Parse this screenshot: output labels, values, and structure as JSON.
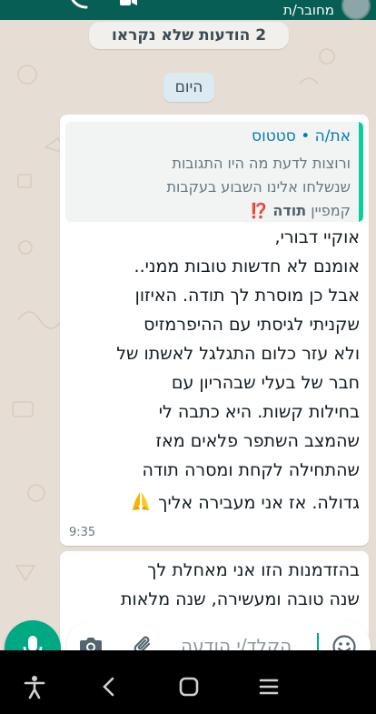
{
  "header": {
    "status": "מחובר/ת"
  },
  "chat": {
    "unread_banner": "2 הודעות שלא נקראו",
    "date_divider": "היום",
    "message1": {
      "quote": {
        "title": "את/ה • סטטוס",
        "line1": "ורוצות לדעת מה היו התגובות",
        "line2": "שנשלחו אלינו השבוע בעקבות",
        "line3_prefix": "קמפיין",
        "line3_bold": "תודה",
        "line3_emoji": "⁉️"
      },
      "lines": [
        "אוקיי דבורי,",
        "אומנם לא חדשות טובות ממני..",
        "אבל כן מוסרת לך תודה. האיזון",
        "שקניתי לגיסתי עם ההיפרמזיס",
        "ולא עזר כלום התגלגל לאשתו של",
        "חבר של בעלי שבהריון עם",
        "בחילות קשות. היא כתבה לי",
        "שהמצב השתפר פלאים מאז",
        "שהתחילה לקחת ומסרה תודה",
        "גדולה. אז אני מעבירה אליך"
      ],
      "time": "9:35"
    },
    "message2": {
      "lines": [
        "בהזדמנות הזו אני מאחלת לך",
        "שנה טובה ומעשירה, שנה מלאות"
      ]
    }
  },
  "composer": {
    "placeholder": "הקלד/י הודעה"
  },
  "icons": {
    "mic": "microphone-icon",
    "camera": "camera-icon",
    "attach": "paperclip-icon",
    "emoji": "emoji-icon",
    "pray": "folded-hands-emoji"
  },
  "colors": {
    "header": "#075e54",
    "accent": "#00a884",
    "quote_bar": "#06cf9c",
    "quote_title": "#027eb5",
    "chat_bg": "#e6ddd4",
    "date_pill": "#dceaf2"
  }
}
